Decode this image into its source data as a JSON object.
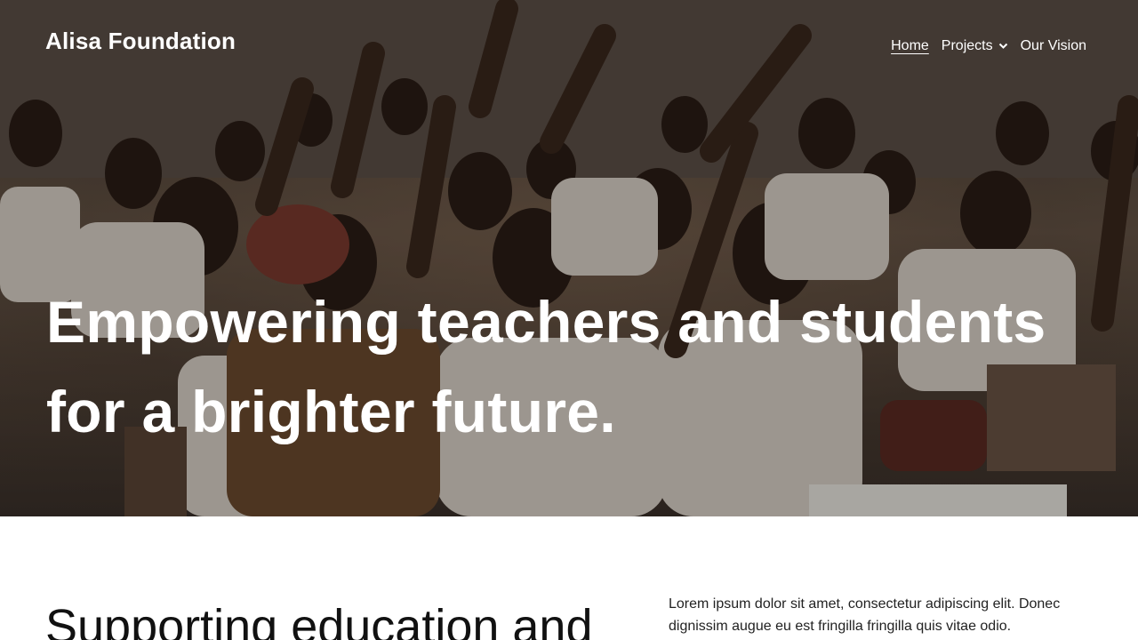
{
  "site": {
    "brand": "Alisa Foundation"
  },
  "nav": {
    "items": [
      {
        "label": "Home",
        "active": true
      },
      {
        "label": "Projects",
        "has_dropdown": true
      },
      {
        "label": "Our Vision"
      }
    ]
  },
  "hero": {
    "title_line1": "Empowering teachers and students",
    "title_line2": "for a brighter future.",
    "image_subject": "classroom of students in uniforms raising hands"
  },
  "intro": {
    "heading": "Supporting education and",
    "body": "Lorem ipsum dolor sit amet, consectetur adipiscing elit. Donec dignissim augue eu est fringilla fringilla quis vitae odio."
  },
  "colors": {
    "hero_text": "#ffffff",
    "page_background": "#ffffff",
    "body_text": "#222222"
  }
}
